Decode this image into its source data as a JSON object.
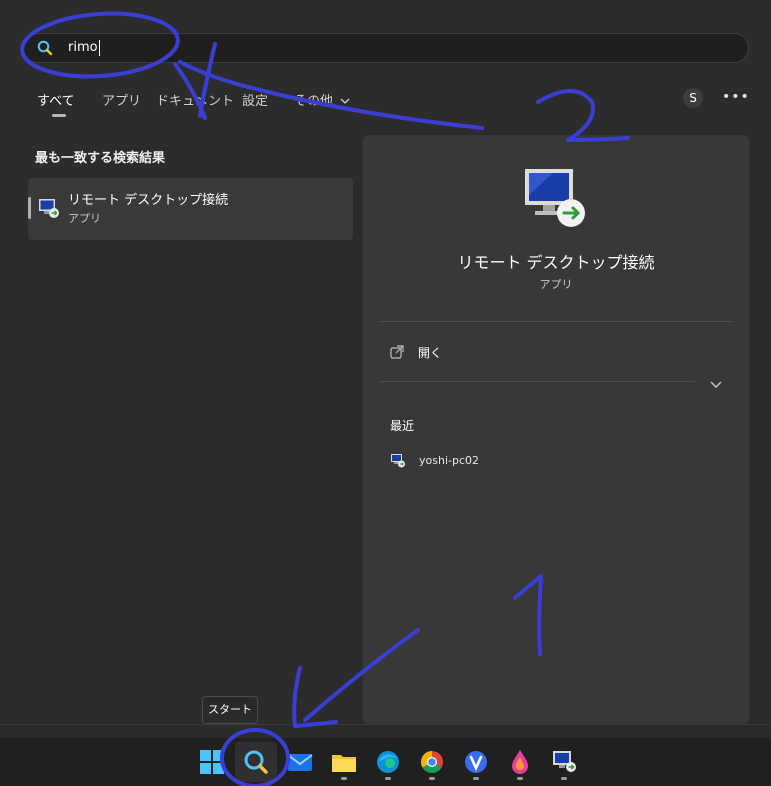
{
  "search": {
    "query": "rimo"
  },
  "tabs": [
    {
      "label": "すべて"
    },
    {
      "label": "アプリ"
    },
    {
      "label": "ドキュメント"
    },
    {
      "label": "設定"
    },
    {
      "label": "その他"
    }
  ],
  "header": {
    "avatar_initial": "S",
    "more_label": "•••"
  },
  "best_match": {
    "section_title": "最も一致する検索結果",
    "item_title": "リモート デスクトップ接続",
    "item_subtitle": "アプリ"
  },
  "detail": {
    "title": "リモート デスクトップ接続",
    "subtitle": "アプリ",
    "open_label": "開く",
    "recent_title": "最近",
    "recent_items": [
      {
        "label": "yoshi-pc02"
      }
    ]
  },
  "tooltip": {
    "label": "スタート"
  },
  "taskbar": {
    "items": [
      "windows-start",
      "search",
      "mail",
      "file-explorer",
      "edge",
      "chrome",
      "vivaldi",
      "paint-drop",
      "remote-desktop"
    ]
  },
  "annotations": {
    "digit_one": "1",
    "digit_two": "2"
  },
  "colors": {
    "panel_bg": "#2c2c2c",
    "detail_bg": "#383838",
    "taskbar_bg": "#202020",
    "annotation_ink": "#3a3fd4"
  }
}
